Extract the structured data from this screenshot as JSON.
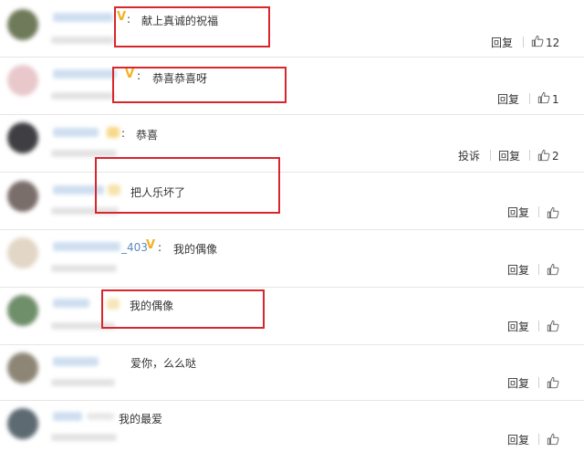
{
  "colors": {
    "accent_red": "#d9262c",
    "vip_gold": "#f2b21e",
    "link_blue": "#5a8ac0"
  },
  "comments": [
    {
      "username": "",
      "vip": "V",
      "colon": ":",
      "text": "献上真诚的祝福",
      "report": "",
      "reply": "回复",
      "likes": "12"
    },
    {
      "username": "",
      "vip": "V",
      "colon": ":",
      "text": "恭喜恭喜呀",
      "report": "",
      "reply": "回复",
      "likes": "1"
    },
    {
      "username": "",
      "vip": "",
      "colon": ":",
      "text": "恭喜",
      "report": "投诉",
      "reply": "回复",
      "likes": "2"
    },
    {
      "username": "",
      "vip": "",
      "colon": "",
      "text": "把人乐坏了",
      "report": "",
      "reply": "回复",
      "likes": ""
    },
    {
      "username": "_403",
      "vip": "V",
      "colon": ":",
      "text": "我的偶像",
      "report": "",
      "reply": "回复",
      "likes": ""
    },
    {
      "username": "",
      "vip": "",
      "colon": "",
      "text": "我的偶像",
      "report": "",
      "reply": "回复",
      "likes": ""
    },
    {
      "username": "",
      "vip": "",
      "colon": "",
      "text": "爱你，么么哒",
      "report": "",
      "reply": "回复",
      "likes": ""
    },
    {
      "username": "",
      "vip": "",
      "colon": "",
      "text": "我的最爱",
      "report": "",
      "reply": "回复",
      "likes": ""
    }
  ]
}
